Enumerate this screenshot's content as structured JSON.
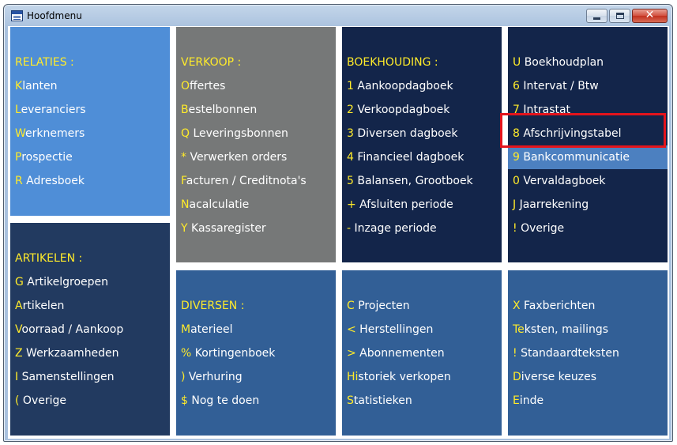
{
  "window": {
    "title": "Hoofdmenu",
    "controls": {
      "minimize": "",
      "maximize": "",
      "close": "✕"
    }
  },
  "colors": {
    "relaties_panel": "#4f8ed7",
    "verkoop_panel": "#767878",
    "dark_panel": "#13254a",
    "artikelen_panel": "#223a60",
    "blue_panel": "#325f96",
    "key": "#ffeb2a",
    "text": "#ffffff",
    "selection": "#4c80c0",
    "selection_border": "#e4141c"
  },
  "panels": {
    "relaties": {
      "heading": "RELATIES :",
      "items": [
        {
          "key": "K",
          "rest": "lanten"
        },
        {
          "key": "L",
          "rest": "everanciers"
        },
        {
          "key": "W",
          "rest": "erknemers"
        },
        {
          "key": "P",
          "rest": "rospectie"
        },
        {
          "key": "R",
          "rest": " Adresboek"
        }
      ]
    },
    "verkoop": {
      "heading": "VERKOOP :",
      "items": [
        {
          "key": "O",
          "rest": "ffertes"
        },
        {
          "key": "B",
          "rest": "estelbonnen"
        },
        {
          "key": "Q",
          "rest": " Leveringsbonnen"
        },
        {
          "key": "*",
          "rest": " Verwerken orders"
        },
        {
          "key": "F",
          "rest": "acturen / Creditnota's"
        },
        {
          "key": "N",
          "rest": "acalculatie"
        },
        {
          "key": "Y",
          "rest": " Kassaregister"
        }
      ]
    },
    "boekhouding": {
      "heading": "BOEKHOUDING :",
      "items": [
        {
          "key": "1",
          "rest": " Aankoopdagboek"
        },
        {
          "key": "2",
          "rest": " Verkoopdagboek"
        },
        {
          "key": "3",
          "rest": " Diversen dagboek"
        },
        {
          "key": "4",
          "rest": " Financieel dagboek"
        },
        {
          "key": "5",
          "rest": " Balansen, Grootboek"
        },
        {
          "key": "+",
          "rest": " Afsluiten periode"
        },
        {
          "key": "-",
          "rest": " Inzage periode"
        }
      ]
    },
    "overige_boekhouding": {
      "items": [
        {
          "key": "U",
          "rest": " Boekhoudplan"
        },
        {
          "key": "6",
          "rest": " Intervat / Btw"
        },
        {
          "key": "7",
          "rest": " Intrastat"
        },
        {
          "key": "8",
          "rest": " Afschrijvingstabel"
        },
        {
          "key": "9",
          "rest": " Bankcommunicatie"
        },
        {
          "key": "0",
          "rest": " Vervaldagboek"
        },
        {
          "key": "J",
          "rest": " Jaarrekening"
        },
        {
          "key": "!",
          "rest": " Overige"
        }
      ]
    },
    "artikelen": {
      "heading": "ARTIKELEN :",
      "items": [
        {
          "key": "G",
          "rest": " Artikelgroepen"
        },
        {
          "key": "A",
          "rest": "rtikelen"
        },
        {
          "key": "V",
          "rest": "oorraad / Aankoop"
        },
        {
          "key": "Z",
          "rest": " Werkzaamheden"
        },
        {
          "key": "I",
          "rest": " Samenstellingen"
        },
        {
          "key": "(",
          "rest": " Overige"
        }
      ]
    },
    "diversen": {
      "heading": "DIVERSEN :",
      "items": [
        {
          "key": "M",
          "rest": "aterieel"
        },
        {
          "key": "%",
          "rest": " Kortingenboek"
        },
        {
          "key": ")",
          "rest": " Verhuring"
        },
        {
          "key": "$",
          "rest": " Nog te doen"
        }
      ]
    },
    "projecten": {
      "items": [
        {
          "key": "C",
          "rest": " Projecten"
        },
        {
          "key": "<",
          "rest": " Herstellingen"
        },
        {
          "key": ">",
          "rest": " Abonnementen"
        },
        {
          "key": "Hi",
          "rest": "storiek verkopen"
        },
        {
          "key": "S",
          "rest": "tatistieken"
        }
      ]
    },
    "communicatie": {
      "items": [
        {
          "key": "X",
          "rest": " Faxberichten"
        },
        {
          "key": "Te",
          "rest": "ksten, mailings"
        },
        {
          "key": "!",
          "rest": " Standaardteksten"
        },
        {
          "key": "D",
          "rest": "iverse keuzes"
        },
        {
          "key": "E",
          "rest": "inde"
        }
      ]
    }
  }
}
